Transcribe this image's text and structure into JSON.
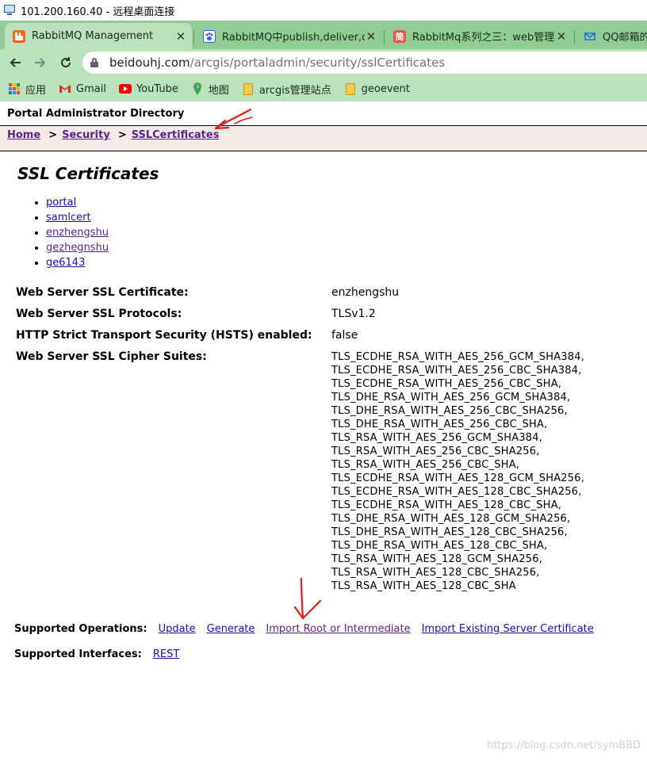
{
  "rdp": {
    "title": "101.200.160.40 - 远程桌面连接"
  },
  "tabs": [
    {
      "label": "RabbitMQ Management",
      "favicon": "rabbitmq-icon",
      "color": "#f26522"
    },
    {
      "label": "RabbitMQ中publish,deliver,con",
      "favicon": "baidu-paw-icon",
      "color": "#2d64d8"
    },
    {
      "label": "RabbitMq系列之三：web管理界",
      "favicon": "jianshu-icon",
      "color": "#e9544a"
    },
    {
      "label": "QQ邮箱的P",
      "favicon": "qq-mail-icon",
      "color": "#2a6be0"
    }
  ],
  "address": {
    "host": "beidouhj.com",
    "path": "/arcgis/portaladmin/security/sslCertificates"
  },
  "bookmarks": [
    {
      "label": "应用",
      "icon": "apps-grid-icon"
    },
    {
      "label": "Gmail",
      "icon": "gmail-icon"
    },
    {
      "label": "YouTube",
      "icon": "youtube-icon"
    },
    {
      "label": "地图",
      "icon": "maps-icon"
    },
    {
      "label": "arcgis管理站点",
      "icon": "folder-icon"
    },
    {
      "label": "geoevent",
      "icon": "folder-icon"
    }
  ],
  "page": {
    "header": "Portal Administrator Directory",
    "breadcrumb": {
      "home": "Home",
      "security": "Security",
      "current": "SSLCertificates",
      "sep": ">"
    },
    "title": "SSL Certificates",
    "certificates": [
      "portal",
      "samlcert",
      "enzhengshu",
      "gezhegnshu",
      "ge6143"
    ],
    "properties": {
      "web_server_cert": {
        "name": "Web Server SSL Certificate:",
        "value": "enzhengshu"
      },
      "protocols": {
        "name": "Web Server SSL Protocols:",
        "value": "TLSv1.2"
      },
      "hsts": {
        "name": "HTTP Strict Transport Security (HSTS) enabled:",
        "value": "false"
      },
      "cipher_suites": {
        "name": "Web Server SSL Cipher Suites:",
        "values": [
          "TLS_ECDHE_RSA_WITH_AES_256_GCM_SHA384,",
          "TLS_ECDHE_RSA_WITH_AES_256_CBC_SHA384,",
          "TLS_ECDHE_RSA_WITH_AES_256_CBC_SHA,",
          "TLS_DHE_RSA_WITH_AES_256_GCM_SHA384,",
          "TLS_DHE_RSA_WITH_AES_256_CBC_SHA256,",
          "TLS_DHE_RSA_WITH_AES_256_CBC_SHA,",
          "TLS_RSA_WITH_AES_256_GCM_SHA384,",
          "TLS_RSA_WITH_AES_256_CBC_SHA256,",
          "TLS_RSA_WITH_AES_256_CBC_SHA,",
          "TLS_ECDHE_RSA_WITH_AES_128_GCM_SHA256,",
          "TLS_ECDHE_RSA_WITH_AES_128_CBC_SHA256,",
          "TLS_ECDHE_RSA_WITH_AES_128_CBC_SHA,",
          "TLS_DHE_RSA_WITH_AES_128_GCM_SHA256,",
          "TLS_DHE_RSA_WITH_AES_128_CBC_SHA256,",
          "TLS_DHE_RSA_WITH_AES_128_CBC_SHA,",
          "TLS_RSA_WITH_AES_128_GCM_SHA256,",
          "TLS_RSA_WITH_AES_128_CBC_SHA256,",
          "TLS_RSA_WITH_AES_128_CBC_SHA"
        ]
      }
    },
    "operations": {
      "label": "Supported Operations:",
      "update": "Update",
      "generate": "Generate",
      "import_root": "Import Root or Intermediate",
      "import_existing": "Import Existing Server Certificate"
    },
    "interfaces": {
      "label": "Supported Interfaces:",
      "rest": "REST"
    }
  },
  "watermark": "https://blog.csdn.net/symBBD",
  "colors": {
    "tabstrip": "#8fcd95",
    "toolbar": "#b9e2bd",
    "breadcrumb_bg": "#f2e9e9",
    "link": "#1a0dab",
    "visited": "#5b2582",
    "annotation": "#e01b1b"
  }
}
